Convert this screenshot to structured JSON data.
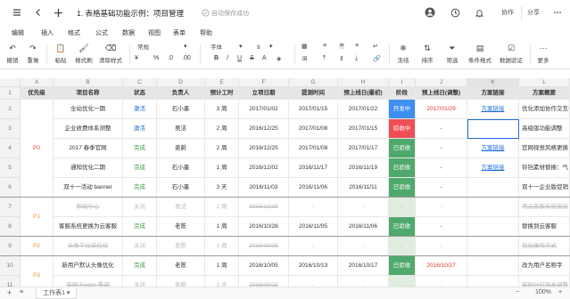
{
  "topbar": {
    "title": "1. 表格基础功能示例：项目管理",
    "save_status": "自动保存成功",
    "collab_label": "协作",
    "share_label": "分享"
  },
  "menu": [
    "编辑",
    "插入",
    "格式",
    "公式",
    "数据",
    "视图",
    "表单",
    "帮助"
  ],
  "toolbar": {
    "undo": "撤销",
    "redo": "重做",
    "paste": "粘贴",
    "format_painter": "格式刷",
    "clear_format": "清除样式",
    "number_format": "常规",
    "font": "字体",
    "font_size": "9",
    "freeze": "冻结",
    "sort": "排序",
    "filter": "筛选",
    "cond_format": "条件格式",
    "data_validation": "数据验证",
    "more": "更多"
  },
  "columns": [
    "A",
    "B",
    "C",
    "D",
    "E",
    "F",
    "G",
    "H",
    "I",
    "J",
    "K",
    "L"
  ],
  "headers": [
    "优先级",
    "项目名称",
    "状态",
    "负责人",
    "预计工时",
    "立项日期",
    "提测时间",
    "预上线日(最初)",
    "阶段",
    "预上线日(调整)",
    "方案链接",
    "方案概要"
  ],
  "groups": [
    {
      "label": "P0",
      "color": "#e53935"
    },
    {
      "label": "P1",
      "color": "#ef8f2f"
    },
    {
      "label": "P2",
      "color": "#ef8f2f"
    },
    {
      "label": "P3",
      "color": "#ef8f2f"
    }
  ],
  "rows": [
    {
      "num": "2",
      "name": "全站优化一期",
      "status": "激活",
      "owner": "石小墨",
      "hours": "3 周",
      "start": "2017/01/02",
      "test": "2017/01/15",
      "plan": "2017/01/22",
      "stage": "开发中",
      "adj": "2017/01/29",
      "link": "方案链接",
      "summary": "优化添加协作交互调整; UI整体优化"
    },
    {
      "num": "3",
      "name": "企业收费体系测整",
      "status": "激活",
      "owner": "吴洁",
      "hours": "2 周",
      "start": "2016/12/25",
      "test": "2017/01/08",
      "plan": "2017/01/15",
      "stage": "验收中",
      "adj": "-",
      "link": "",
      "summary": "高级版功能调整"
    },
    {
      "num": "4",
      "name": "2017 春季官网",
      "status": "完成",
      "owner": "姜蔚",
      "hours": "2 周",
      "start": "2016/12/25",
      "test": "2017/01/08",
      "plan": "2017/01/17",
      "stage": "已验收",
      "adj": "-",
      "link": "方案链接",
      "summary": "官网视觉风格更换"
    },
    {
      "num": "5",
      "name": "通知优化二期",
      "status": "完成",
      "owner": "石小墨",
      "hours": "1 周",
      "start": "2016/12/02",
      "test": "2016/11/17",
      "plan": "2016/11/19",
      "stage": "已验收",
      "adj": "-",
      "link": "方案链接",
      "summary": "铃铛素材替换：气"
    },
    {
      "num": "6",
      "name": "双十一活动 banner",
      "status": "完成",
      "owner": "石小墨",
      "hours": "3 天",
      "start": "2016/11/03",
      "test": "2016/11/06",
      "plan": "2016/11/11",
      "stage": "已验收",
      "adj": "-",
      "link": "",
      "summary": "双十一企业版促销"
    },
    {
      "num": "7",
      "name": "帮助中心",
      "status": "关闭",
      "owner": "吴洁",
      "hours": "2 周",
      "start": "2016/12/25",
      "test": "-",
      "plan": "-",
      "stage": "-",
      "adj": "-",
      "link": "",
      "summary": "用云客服系统直接"
    },
    {
      "num": "8",
      "name": "客服系统更换为云客服",
      "status": "完成",
      "owner": "老陈",
      "hours": "1 周",
      "start": "2016/10/28",
      "test": "2016/11/05",
      "plan": "2016/11/06",
      "stage": "已验收",
      "adj": "-",
      "link": "",
      "summary": "替换到云客服"
    },
    {
      "num": "9",
      "name": "头像下拉单优化",
      "status": "关闭",
      "owner": "老陈",
      "hours": "1 周",
      "start": "2016/09/25",
      "test": "-",
      "plan": "-",
      "stage": "-",
      "adj": "-",
      "link": "",
      "summary": "优化操作方式"
    },
    {
      "num": "10",
      "name": "新用户默认头像优化",
      "status": "完成",
      "owner": "老陈",
      "hours": "1 周",
      "start": "2016/10/05",
      "test": "2016/10/13",
      "plan": "2016/10/17",
      "stage": "已验收",
      "adj": "2016/10/27",
      "link": "",
      "summary": "改为用户名称字"
    },
    {
      "num": "11",
      "name": "官网 Footer 重调",
      "status": "关闭",
      "owner": "姜蔚",
      "hours": "3 天",
      "start": "2016/09/25",
      "test": "-",
      "plan": "-",
      "stage": "-",
      "adj": "-",
      "link": "",
      "summary": "官网分区版本调整"
    }
  ],
  "bottom": {
    "sheet_name": "工作表1",
    "zoom": "100%"
  }
}
